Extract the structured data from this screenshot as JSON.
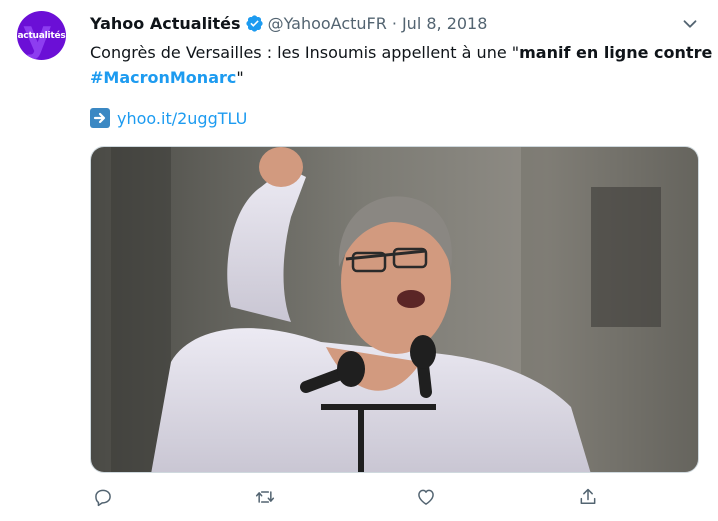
{
  "author": {
    "display_name": "Yahoo Actualités",
    "handle": "@YahooActuFR",
    "separator": "·",
    "date": "Jul 8, 2018",
    "avatar_text": "actualités",
    "avatar_color": "#6b0fd6"
  },
  "tweet": {
    "text_prefix": "Congrès de Versailles : les Insoumis appellent à une \"",
    "text_bold": "manif en ligne contre",
    "hashtag": "#MacronMonarc",
    "text_suffix": "\"",
    "link_emoji": "right-arrow-emoji",
    "link_text": "yhoo.it/2uggTLU"
  },
  "media": {
    "description_icon": "photo"
  },
  "actions": [
    "reply-icon",
    "retweet-icon",
    "like-icon",
    "share-icon"
  ],
  "colors": {
    "link": "#1d9bf0",
    "secondary_text": "#536471",
    "verified": "#1d9bf0"
  }
}
